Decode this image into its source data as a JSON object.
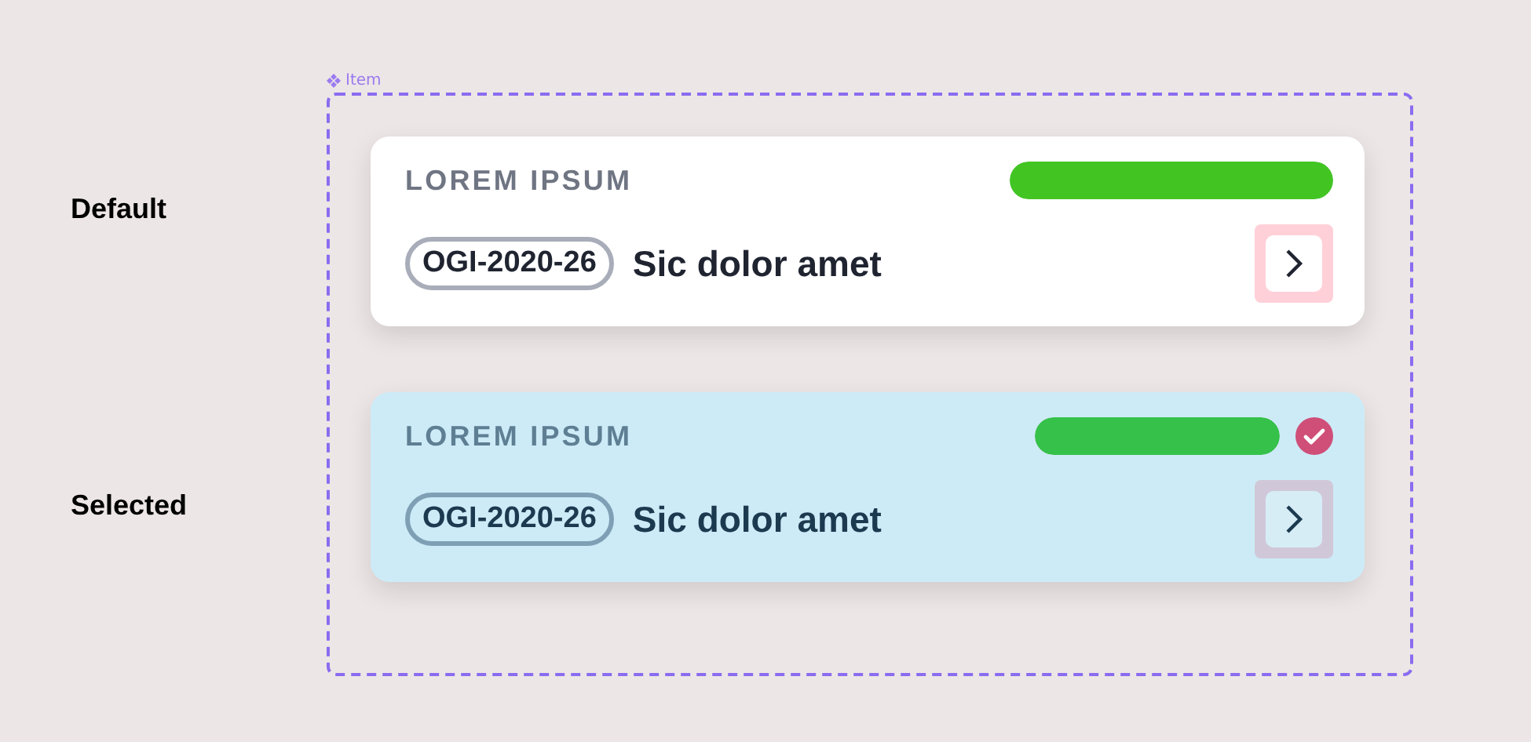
{
  "frame": {
    "label": "Item"
  },
  "variants": [
    {
      "label": "Default",
      "card": {
        "selected": false,
        "title": "LOREM IPSUM",
        "level": 1,
        "code": "OGI-2020-26",
        "name": "Sic dolor amet"
      }
    },
    {
      "label": "Selected",
      "card": {
        "selected": true,
        "title": "LOREM IPSUM",
        "level": 1,
        "code": "OGI-2020-26",
        "name": "Sic dolor amet"
      }
    }
  ]
}
